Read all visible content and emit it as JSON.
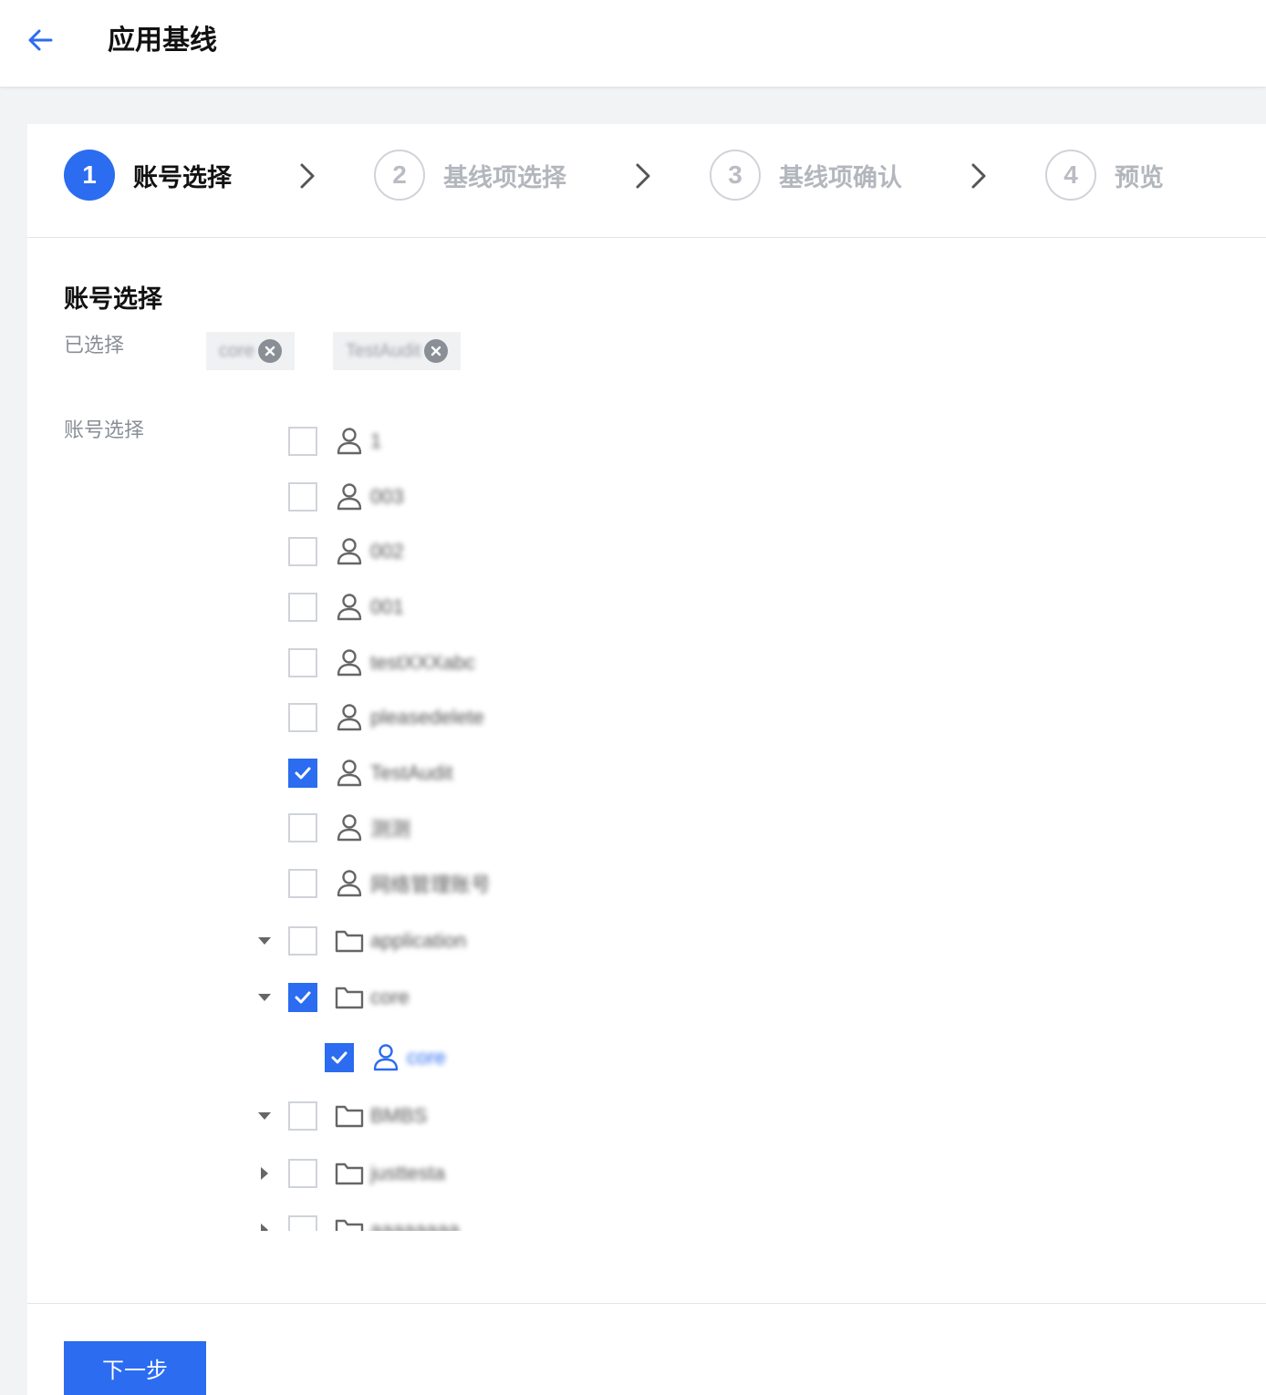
{
  "header": {
    "title": "应用基线"
  },
  "steps": [
    {
      "number": "1",
      "label": "账号选择",
      "state": "active"
    },
    {
      "number": "2",
      "label": "基线项选择",
      "state": "inactive"
    },
    {
      "number": "3",
      "label": "基线项确认",
      "state": "inactive"
    },
    {
      "number": "4",
      "label": "预览",
      "state": "inactive"
    }
  ],
  "section": {
    "title": "账号选择",
    "selected_label": "已选择",
    "tree_label": "账号选择"
  },
  "selected_tags": [
    "core",
    "TestAudit"
  ],
  "tree": [
    {
      "type": "user",
      "label": "1",
      "checked": false
    },
    {
      "type": "user",
      "label": "003",
      "checked": false
    },
    {
      "type": "user",
      "label": "002",
      "checked": false
    },
    {
      "type": "user",
      "label": "001",
      "checked": false
    },
    {
      "type": "user",
      "label": "testXXXabc",
      "checked": false
    },
    {
      "type": "user",
      "label": "pleasedelete",
      "checked": false
    },
    {
      "type": "user",
      "label": "TestAudit",
      "checked": true
    },
    {
      "type": "user",
      "label": "测测",
      "checked": false
    },
    {
      "type": "user",
      "label": "网络管理账号",
      "checked": false
    },
    {
      "type": "folder",
      "label": "application",
      "checked": false,
      "expanded": true
    },
    {
      "type": "folder",
      "label": "core",
      "checked": true,
      "expanded": true
    },
    {
      "type": "user",
      "label": "core",
      "checked": true,
      "child": true,
      "highlight": true
    },
    {
      "type": "folder",
      "label": "BMBS",
      "checked": false,
      "expanded": true
    },
    {
      "type": "folder",
      "label": "justtesta",
      "checked": false,
      "expanded": false
    },
    {
      "type": "folder",
      "label": "aaaaaaaa",
      "checked": false,
      "expanded": false
    }
  ],
  "footer": {
    "next_label": "下一步"
  },
  "colors": {
    "primary": "#2b6cf0",
    "border": "#cfd3d9",
    "muted": "#8a8f96"
  }
}
